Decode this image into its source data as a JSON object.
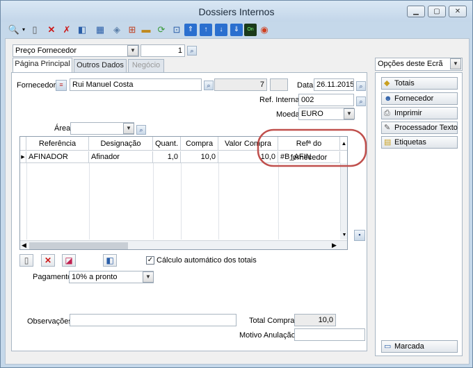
{
  "window": {
    "title": "Dossiers Internos"
  },
  "top": {
    "price_select": "Preço Fornecedor",
    "qty": "1"
  },
  "tabs": [
    {
      "label": "Página Principal"
    },
    {
      "label": "Outros Dados"
    },
    {
      "label": "Negócio"
    }
  ],
  "form": {
    "fornecedor_label": "Fornecedor",
    "fornecedor_value": "Rui Manuel Costa",
    "fornecedor_num": "7",
    "data_label": "Data",
    "data_value": "26.11.2015",
    "refint_label": "Ref. Interna",
    "refint_value": "002",
    "moeda_label": "Moeda",
    "moeda_value": "EURO",
    "area_label": "Área",
    "area_value": ""
  },
  "grid": {
    "columns": [
      "Referência",
      "Designação",
      "Quant.",
      "Compra",
      "Valor Compra",
      "Refª do fornecedor"
    ],
    "rows": [
      [
        "AFINADOR",
        "Afinador",
        "1,0",
        "10,0",
        "10,0",
        "#B_AFIN"
      ]
    ]
  },
  "calc": {
    "auto_label": "Cálculo automático dos totais",
    "checked": true
  },
  "pagamento": {
    "label": "Pagamento",
    "value": "10% a pronto"
  },
  "bottom": {
    "obs_label": "Observações",
    "total_label": "Total Compra",
    "total_value": "10,0",
    "motivo_label": "Motivo Anulação"
  },
  "side": {
    "header": "Opções deste Ecrã",
    "buttons": [
      "Totais",
      "Fornecedor",
      "Imprimir",
      "Processador Texto",
      "Etiquetas"
    ],
    "marcada": "Marcada"
  },
  "colors": {
    "highlight": "#c0504d",
    "accent": "#2a5ea8"
  }
}
